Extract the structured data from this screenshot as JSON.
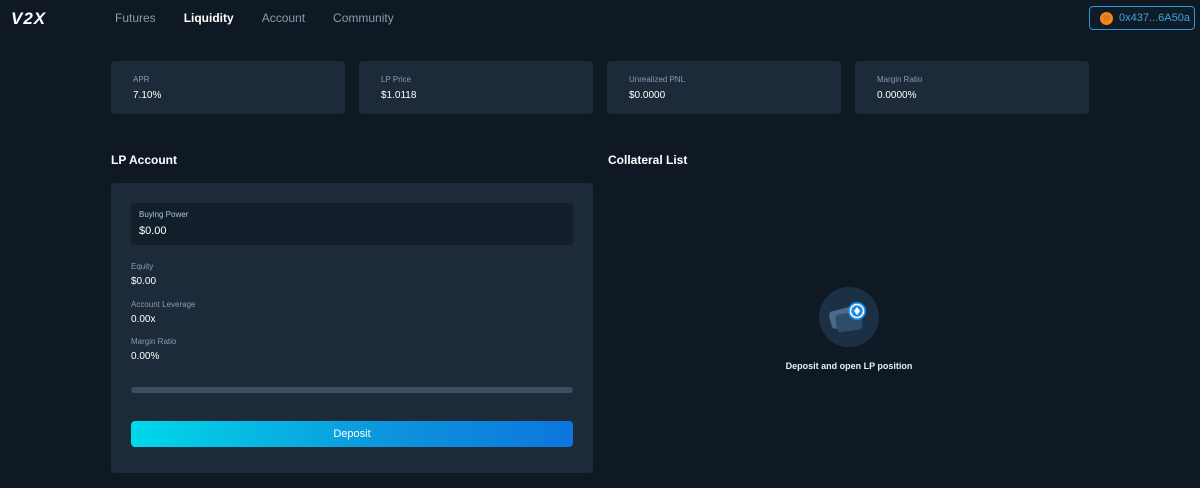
{
  "header": {
    "logo": "V2X",
    "nav": [
      {
        "label": "Futures",
        "active": false
      },
      {
        "label": "Liquidity",
        "active": true
      },
      {
        "label": "Account",
        "active": false
      },
      {
        "label": "Community",
        "active": false
      }
    ],
    "wallet": {
      "address": "0x437...6A50a",
      "icon": "metamask-fox-icon"
    }
  },
  "stats": [
    {
      "label": "APR",
      "value": "7.10%"
    },
    {
      "label": "LP Price",
      "value": "$1.0118"
    },
    {
      "label": "Unrealized PNL",
      "value": "$0.0000"
    },
    {
      "label": "Margin Ratio",
      "value": "0.0000%"
    }
  ],
  "lp_account": {
    "title": "LP Account",
    "buying_power": {
      "label": "Buying Power",
      "value": "$0.00"
    },
    "fields": [
      {
        "label": "Equity",
        "value": "$0.00"
      },
      {
        "label": "Account Leverage",
        "value": "0.00x"
      },
      {
        "label": "Margin Ratio",
        "value": "0.00%"
      }
    ],
    "progress_fraction": 0,
    "deposit_label": "Deposit"
  },
  "collateral": {
    "title": "Collateral List",
    "empty_message": "Deposit and open LP position",
    "empty_icon": "wallet-coin-icon"
  },
  "colors": {
    "background": "#0f1923",
    "card": "#1c2a3a",
    "accent": "#2a9bd8",
    "button_gradient_start": "#00d8ea",
    "button_gradient_end": "#0c76dd"
  }
}
